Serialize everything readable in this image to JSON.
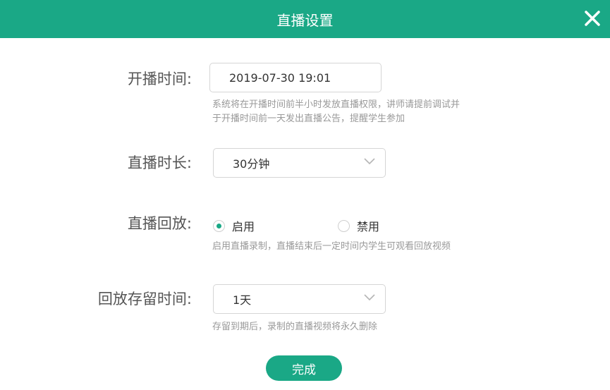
{
  "dialog": {
    "title": "直播设置",
    "close_icon": "close-icon"
  },
  "start_time": {
    "label": "开播时间:",
    "value": "2019-07-30 19:01",
    "hint_line1": "系统将在开播时间前半小时发放直播权限，讲师请提前调试并",
    "hint_line2": "于开播时间前一天发出直播公告，提醒学生参加"
  },
  "duration": {
    "label": "直播时长:",
    "value": "30分钟"
  },
  "replay": {
    "label": "直播回放:",
    "options": [
      {
        "label": "启用",
        "checked": true
      },
      {
        "label": "禁用",
        "checked": false
      }
    ],
    "hint": "启用直播录制，直播结束后一定时间内学生可观看回放视频"
  },
  "retention": {
    "label": "回放存留时间:",
    "value": "1天",
    "hint": "存留到期后，录制的直播视频将永久删除"
  },
  "done_button": "完成",
  "colors": {
    "accent": "#1aa886",
    "hint": "#999999"
  }
}
